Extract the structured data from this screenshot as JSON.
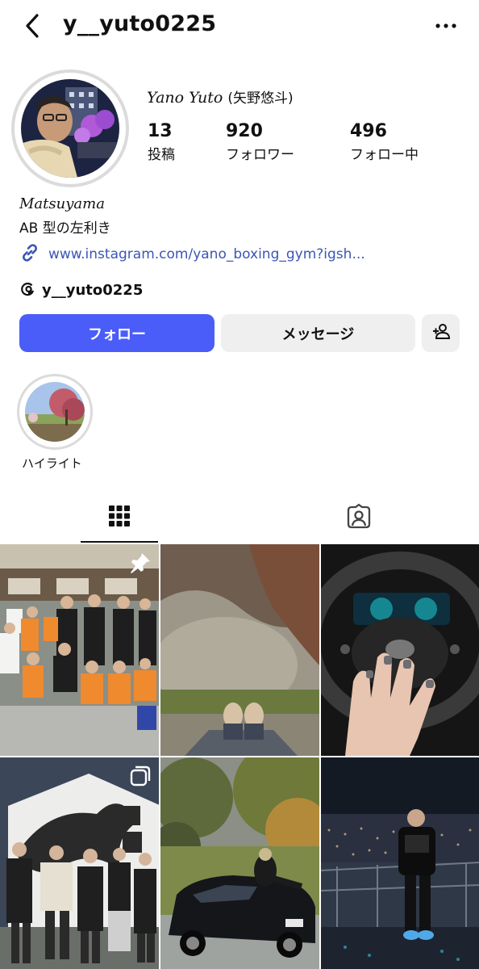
{
  "header": {
    "username": "y__yuto0225"
  },
  "profile": {
    "display_name_latin": "Yano Yuto",
    "display_name_jp": "(矢野悠斗)",
    "stats": [
      {
        "value": "13",
        "label": "投稿"
      },
      {
        "value": "920",
        "label": "フォロワー"
      },
      {
        "value": "496",
        "label": "フォロー中"
      }
    ],
    "bio_line1": "Matsuyama",
    "bio_line2": "AB 型の左利き",
    "link": "www.instagram.com/yano_boxing_gym?igsh...",
    "threads_handle": "y__yuto0225"
  },
  "actions": {
    "follow_label": "フォロー",
    "message_label": "メッセージ"
  },
  "highlights": [
    {
      "label": "ハイライト"
    }
  ],
  "posts": [
    {
      "subject": "team-photo",
      "badge": "pin-icon"
    },
    {
      "subject": "rocks-and-shoes",
      "badge": ""
    },
    {
      "subject": "steering-wheel-hand",
      "badge": ""
    },
    {
      "subject": "horse-mural-group",
      "badge": "multi-photo-icon"
    },
    {
      "subject": "lexus-car",
      "badge": ""
    },
    {
      "subject": "city-night-view",
      "badge": ""
    }
  ],
  "colors": {
    "accent": "#4a5df9",
    "link": "#3b56b5",
    "secondary_button": "#efeff0"
  }
}
